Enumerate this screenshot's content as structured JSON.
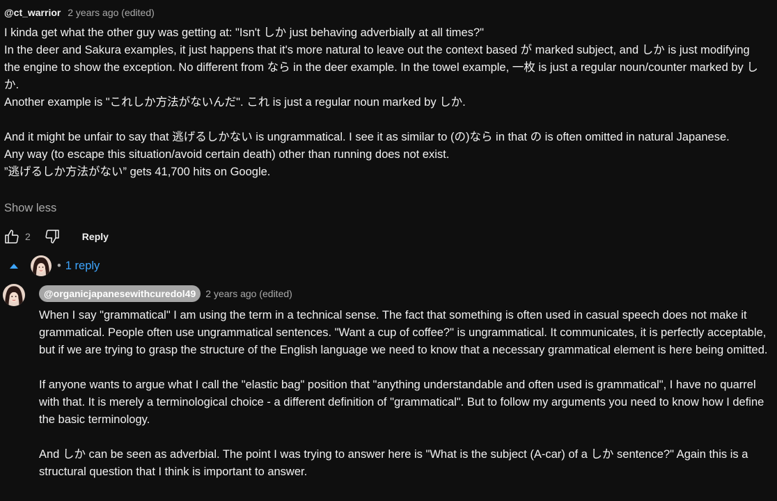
{
  "comment": {
    "author": "@ct_warrior",
    "meta": "2 years ago (edited)",
    "lines": [
      "I kinda get what the other guy was getting at: \"Isn't しか just behaving adverbially at all times?\"",
      "In the deer and Sakura examples, it just happens that it's more natural to leave out the context based が marked subject, and しか is just modifying the engine to show the exception. No different from なら in the deer example. In the towel example, 一枚 is just a regular noun/counter marked by しか.",
      "Another example is \"これしか方法がないんだ\". これ is just a regular noun marked by しか.",
      "",
      "And it might be unfair to say that 逃げるしかない is ungrammatical. I see it as similar to (の)なら in that の is often omitted in natural Japanese.",
      "Any way (to escape this situation/avoid certain death) other than running does not exist.",
      "”逃げるしか方法がない” gets 41,700 hits on Google."
    ],
    "show_less": "Show less",
    "like_count": "2",
    "reply_label": "Reply",
    "replies_toggle": "1 reply"
  },
  "reply": {
    "author": "@organicjapanesewithcuredol49",
    "meta": "2 years ago (edited)",
    "paragraphs": [
      "When I say \"grammatical\" I am using the term in a technical sense. The fact that something is often used in casual speech does not make it grammatical. People often use ungrammatical sentences. \"Want a cup of coffee?\" is ungrammatical. It communicates, it is perfectly acceptable, but if we are trying to grasp the structure of the English language we need to know that a necessary grammatical element is here being omitted.",
      "If anyone wants to argue what I call the \"elastic bag\" position that \"anything understandable and often used is grammatical\", I have no quarrel with that. It is merely a terminological choice - a different definition of \"grammatical\". But to follow my arguments you need to know how I define the basic terminology.",
      "And しか can be seen as adverbial. The point I was trying to answer here is \"What is the subject (A-car) of a しか sentence?\" Again this is a structural question that I think is important to answer."
    ]
  },
  "icons": {
    "like": "thumbs-up-icon",
    "dislike": "thumbs-down-icon",
    "collapse": "caret-up-icon"
  },
  "colors": {
    "background": "#0f0f0f",
    "text": "#f1f1f1",
    "secondary": "#aaaaaa",
    "link": "#3ea6ff",
    "chip": "#a6a6a6"
  }
}
